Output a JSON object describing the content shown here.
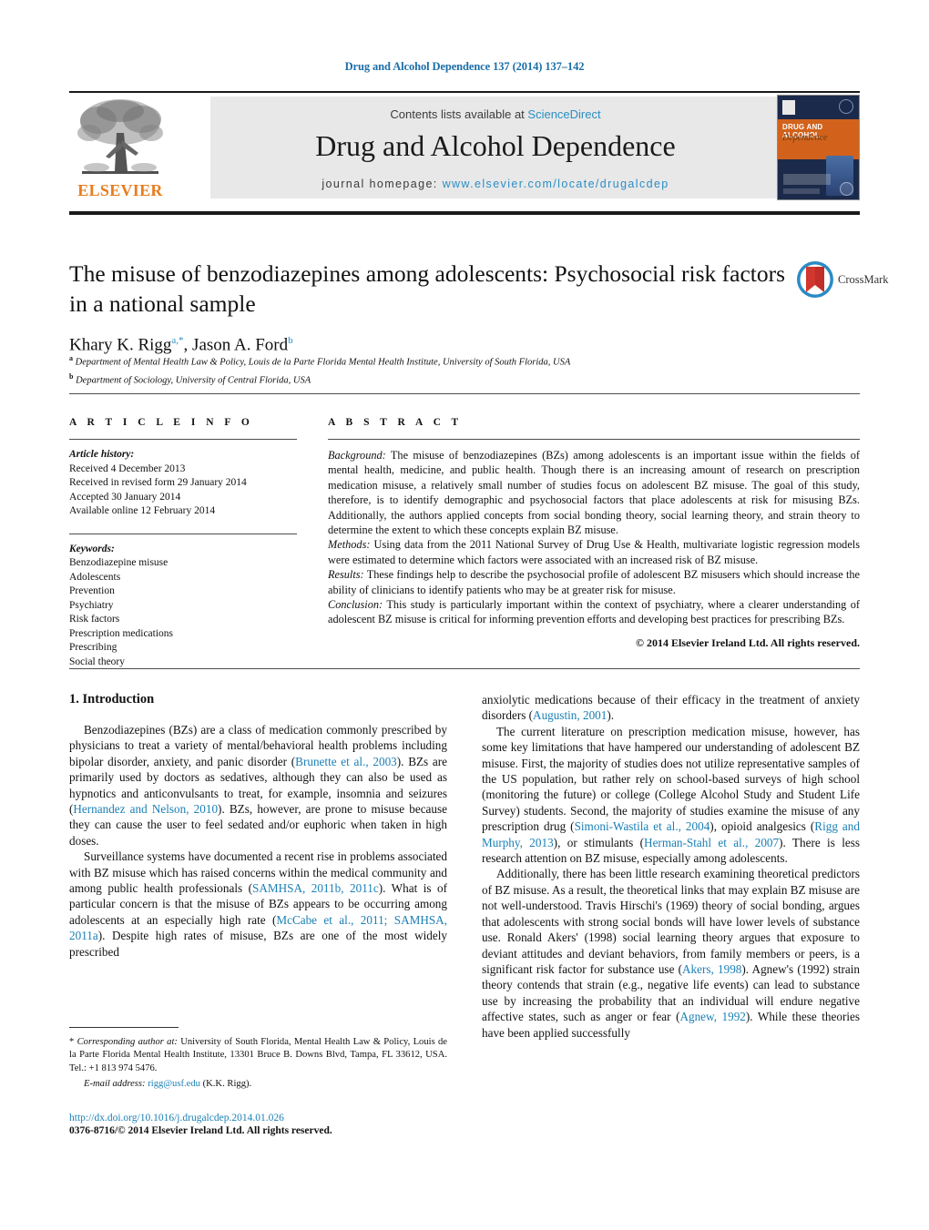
{
  "running_head": "Drug and Alcohol Dependence 137 (2014) 137–142",
  "masthead": {
    "contents_prefix": "Contents lists available at ",
    "sciencedirect": "ScienceDirect",
    "journal_title": "Drug and Alcohol Dependence",
    "homepage_prefix": "journal homepage: ",
    "homepage_url": "www.elsevier.com/locate/drugalcdep",
    "publisher": "ELSEVIER",
    "cover": {
      "line1": "DRUG AND ALCOHOL",
      "line2": "Dependence"
    },
    "colors": {
      "link": "#2b8ec4",
      "elsevier_orange": "#E87D1E",
      "panel_gray": "#e8e8e8",
      "cover_blue": "#1b2a4a",
      "cover_orange": "#d2621b"
    }
  },
  "article": {
    "title": "The misuse of benzodiazepines among adolescents: Psychosocial risk factors in a national sample",
    "authors_html": "Khary K. Rigg<sup>a,&#42;</sup>, Jason A. Ford<sup>b</sup>",
    "affiliation_a": "Department of Mental Health Law & Policy, Louis de la Parte Florida Mental Health Institute, University of South Florida, USA",
    "affiliation_b": "Department of Sociology, University of Central Florida, USA",
    "crossmark_label": "CrossMark"
  },
  "article_info": {
    "heading": "A R T I C L E   I N F O",
    "history_label": "Article history:",
    "history": [
      "Received 4 December 2013",
      "Received in revised form 29 January 2014",
      "Accepted 30 January 2014",
      "Available online 12 February 2014"
    ],
    "keywords_label": "Keywords:",
    "keywords": [
      "Benzodiazepine misuse",
      "Adolescents",
      "Prevention",
      "Psychiatry",
      "Risk factors",
      "Prescription medications",
      "Prescribing",
      "Social theory"
    ]
  },
  "abstract": {
    "heading": "A B S T R A C T",
    "background_label": "Background:",
    "background": " The misuse of benzodiazepines (BZs) among adolescents is an important issue within the fields of mental health, medicine, and public health. Though there is an increasing amount of research on prescription medication misuse, a relatively small number of studies focus on adolescent BZ misuse. The goal of this study, therefore, is to identify demographic and psychosocial factors that place adolescents at risk for misusing BZs. Additionally, the authors applied concepts from social bonding theory, social learning theory, and strain theory to determine the extent to which these concepts explain BZ misuse.",
    "methods_label": "Methods:",
    "methods": " Using data from the 2011 National Survey of Drug Use & Health, multivariate logistic regression models were estimated to determine which factors were associated with an increased risk of BZ misuse.",
    "results_label": "Results:",
    "results": " These findings help to describe the psychosocial profile of adolescent BZ misusers which should increase the ability of clinicians to identify patients who may be at greater risk for misuse.",
    "conclusion_label": "Conclusion:",
    "conclusion": " This study is particularly important within the context of psychiatry, where a clearer understanding of adolescent BZ misuse is critical for informing prevention efforts and developing best practices for prescribing BZs.",
    "copyright": "© 2014 Elsevier Ireland Ltd. All rights reserved."
  },
  "body": {
    "section_heading": "1.  Introduction",
    "left_paragraphs": [
      "Benzodiazepines (BZs) are a class of medication commonly prescribed by physicians to treat a variety of mental/behavioral health problems including bipolar disorder, anxiety, and panic disorder (<span class=\"ref\">Brunette et al., 2003</span>). BZs are primarily used by doctors as sedatives, although they can also be used as hypnotics and anticonvulsants to treat, for example, insomnia and seizures (<span class=\"ref\">Hernandez and Nelson, 2010</span>). BZs, however, are prone to misuse because they can cause the user to feel sedated and/or euphoric when taken in high doses.",
      "Surveillance systems have documented a recent rise in problems associated with BZ misuse which has raised concerns within the medical community and among public health professionals (<span class=\"ref\">SAMHSA, 2011b, 2011c</span>). What is of particular concern is that the misuse of BZs appears to be occurring among adolescents at an especially high rate (<span class=\"ref\">McCabe et al., 2011; SAMHSA, 2011a</span>). Despite high rates of misuse, BZs are one of the most widely prescribed"
    ],
    "right_paragraphs": [
      "anxiolytic medications because of their efficacy in the treatment of anxiety disorders (<span class=\"ref\">Augustin, 2001</span>).",
      "The current literature on prescription medication misuse, however, has some key limitations that have hampered our understanding of adolescent BZ misuse. First, the majority of studies does not utilize representative samples of the US population, but rather rely on school-based surveys of high school (monitoring the future) or college (College Alcohol Study and Student Life Survey) students. Second, the majority of studies examine the misuse of any prescription drug (<span class=\"ref\">Simoni-Wastila et al., 2004</span>), opioid analgesics (<span class=\"ref\">Rigg and Murphy, 2013</span>), or stimulants (<span class=\"ref\">Herman-Stahl et al., 2007</span>). There is less research attention on BZ misuse, especially among adolescents.",
      "Additionally, there has been little research examining theoretical predictors of BZ misuse. As a result, the theoretical links that may explain BZ misuse are not well-understood. Travis Hirschi's (1969) theory of social bonding, argues that adolescents with strong social bonds will have lower levels of substance use. Ronald Akers' (1998) social learning theory argues that exposure to deviant attitudes and deviant behaviors, from family members or peers, is a significant risk factor for substance use (<span class=\"ref\">Akers, 1998</span>). Agnew's (1992) strain theory contends that strain (e.g., negative life events) can lead to substance use by increasing the probability that an individual will endure negative affective states, such as anger or fear (<span class=\"ref\">Agnew, 1992</span>). While these theories have been applied successfully"
    ],
    "right_first_is_continuation": true
  },
  "footer": {
    "corresponding_html": "*  <span class=\"it\">Corresponding author at:</span> University of South Florida, Mental Health Law &amp; Policy, Louis de la Parte Florida Mental Health Institute, 13301 Bruce B. Downs Blvd, Tampa, FL 33612, USA. Tel.: +1 813 974 5476.",
    "email_label": "E-mail address:",
    "email": "rigg@usf.edu",
    "email_owner": "(K.K. Rigg).",
    "doi": "http://dx.doi.org/10.1016/j.drugalcdep.2014.01.026",
    "issn_line": "0376-8716/© 2014 Elsevier Ireland Ltd. All rights reserved."
  }
}
